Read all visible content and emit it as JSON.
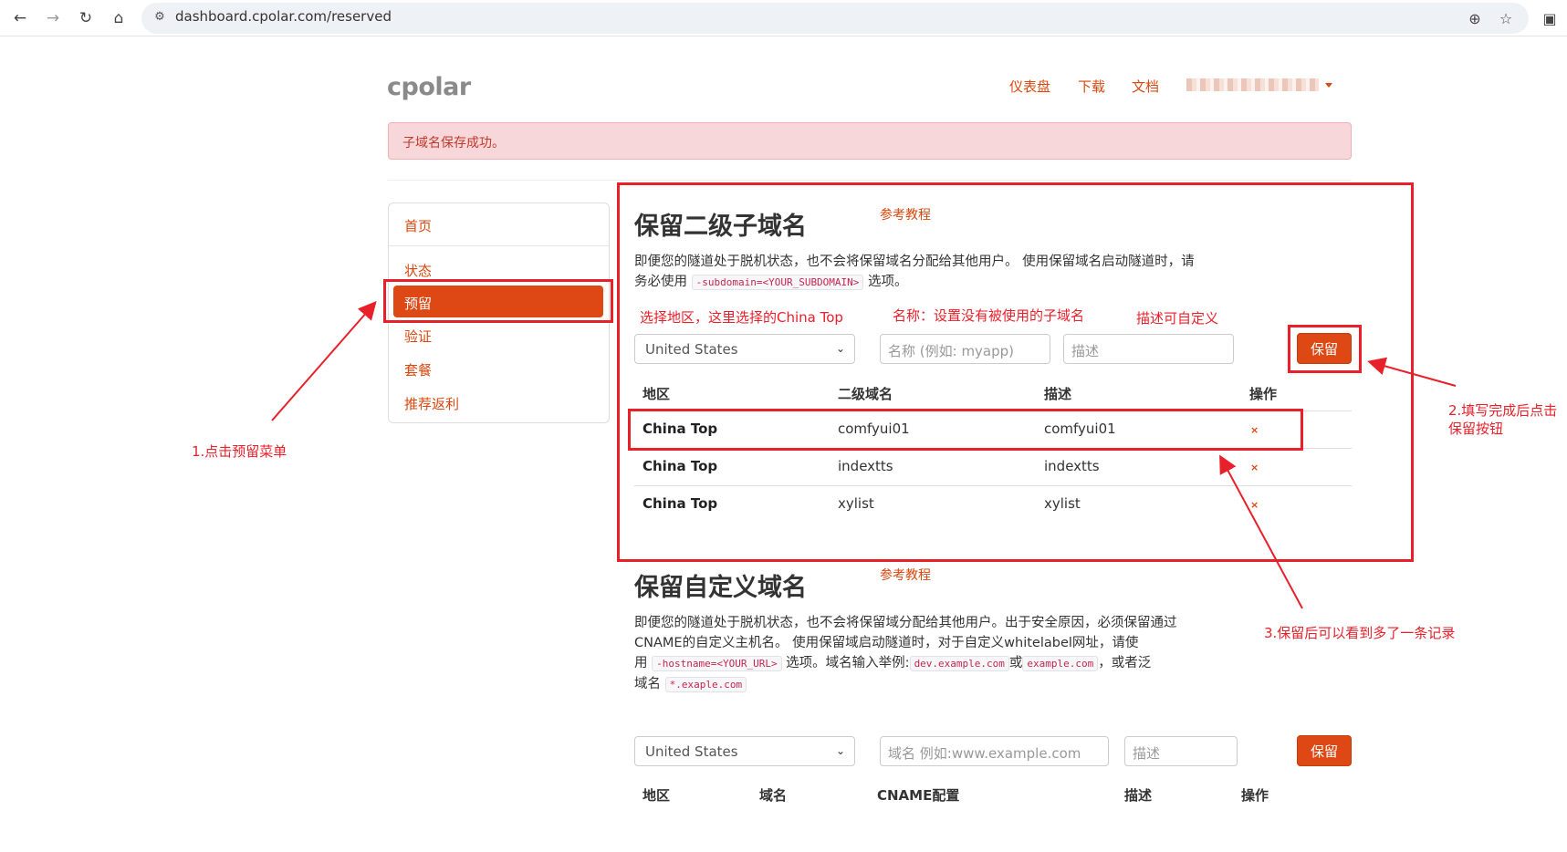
{
  "browser": {
    "url": "dashboard.cpolar.com/reserved",
    "icons": [
      "back-icon",
      "forward-icon",
      "reload-icon",
      "home-icon",
      "site-settings-icon",
      "zoom-icon",
      "bookmark-star-icon",
      "side-panel-icon"
    ]
  },
  "header": {
    "logo": "cpolar",
    "nav": [
      "仪表盘",
      "下载",
      "文档"
    ]
  },
  "alert": "子域名保存成功。",
  "sidebar": {
    "items": [
      "首页",
      "状态",
      "预留",
      "验证",
      "套餐",
      "推荐返利"
    ],
    "active": "预留"
  },
  "subdomain_section": {
    "title": "保留二级子域名",
    "ref_link": "参考教程",
    "desc_pre": "即便您的隧道处于脱机状态，也不会将保留域名分配给其他用户。 使用保留域名启动隧道时，请务必使用",
    "desc_code": "-subdomain=<YOUR_SUBDOMAIN>",
    "desc_post": "选项。",
    "form": {
      "region_value": "United States",
      "name_placeholder": "名称 (例如: myapp)",
      "desc_placeholder": "描述",
      "save_label": "保留"
    },
    "table": {
      "headers": [
        "地区",
        "二级域名",
        "描述",
        "操作"
      ],
      "rows": [
        {
          "region": "China Top",
          "subdomain": "comfyui01",
          "desc": "comfyui01",
          "action": "×"
        },
        {
          "region": "China Top",
          "subdomain": "indextts",
          "desc": "indextts",
          "action": "×"
        },
        {
          "region": "China Top",
          "subdomain": "xylist",
          "desc": "xylist",
          "action": "×"
        }
      ]
    }
  },
  "custom_section": {
    "title": "保留自定义域名",
    "ref_link": "参考教程",
    "desc_line1": "即便您的隧道处于脱机状态，也不会将保留域分配给其他用户。出于安全原因，必须保留通过",
    "desc_line2": "CNAME的自定义主机名。 使用保留域启动隧道时，对于自定义whitelabel网址，请使",
    "desc_line3_pre": "用",
    "desc_code1": "-hostname=<YOUR_URL>",
    "desc_line3_mid": "选项。域名输入举例:",
    "desc_code2": "dev.example.com",
    "desc_or": "或",
    "desc_code3": "example.com",
    "desc_line3_post": "，或者泛",
    "desc_line4_pre": "域名",
    "desc_code4": "*.exaple.com",
    "form": {
      "region_value": "United States",
      "domain_placeholder": "域名 例如:www.example.com",
      "desc_placeholder": "描述",
      "save_label": "保留"
    },
    "table": {
      "headers": [
        "地区",
        "域名",
        "CNAME配置",
        "描述",
        "操作"
      ]
    }
  },
  "annotations": {
    "region_hint": "选择地区，这里选择的China Top",
    "name_hint": "名称：设置没有被使用的子域名",
    "desc_hint": "描述可自定义",
    "step1": "1.点击预留菜单",
    "step2_line1": "2.填写完成后点击",
    "step2_line2": "保留按钮",
    "step3": "3.保留后可以看到多了一条记录",
    "color": "#e8202a"
  },
  "colors": {
    "accent": "#dd4814",
    "link": "#d9480f",
    "alert_bg": "#f8d7da"
  }
}
